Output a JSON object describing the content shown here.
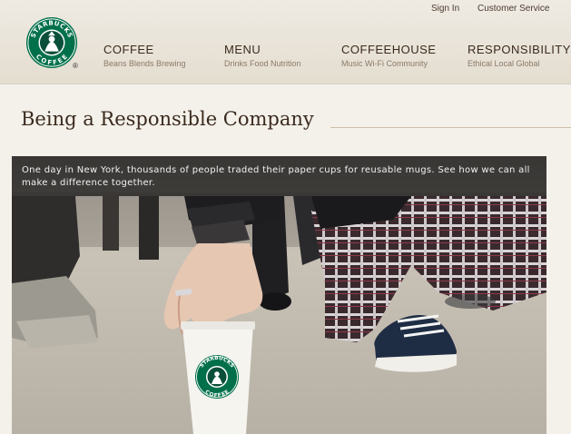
{
  "header": {
    "util_links": {
      "sign_in": "Sign In",
      "customer_service": "Customer Service"
    },
    "logo": {
      "text_top": "STARBUCKS",
      "text_bottom": "COFFEE",
      "registered_mark": "®"
    },
    "nav": [
      {
        "title": "COFFEE",
        "subtitle": "Beans Blends Brewing"
      },
      {
        "title": "MENU",
        "subtitle": "Drinks Food Nutrition"
      },
      {
        "title": "COFFEEHOUSE",
        "subtitle": "Music Wi-Fi Community"
      },
      {
        "title": "RESPONSIBILITY",
        "subtitle": "Ethical Local Global"
      }
    ]
  },
  "main": {
    "title": "Being a Responsible Company",
    "video": {
      "caption": "One day in New York, thousands of people traded their paper cups for reusable mugs. See how we can all make a difference together.",
      "cup_logo_top": "STARBUCKS",
      "cup_logo_bottom": "COFFEE"
    }
  },
  "colors": {
    "brand_green": "#00704a",
    "background": "#f4f1ea",
    "heading": "#3a2a1e"
  }
}
